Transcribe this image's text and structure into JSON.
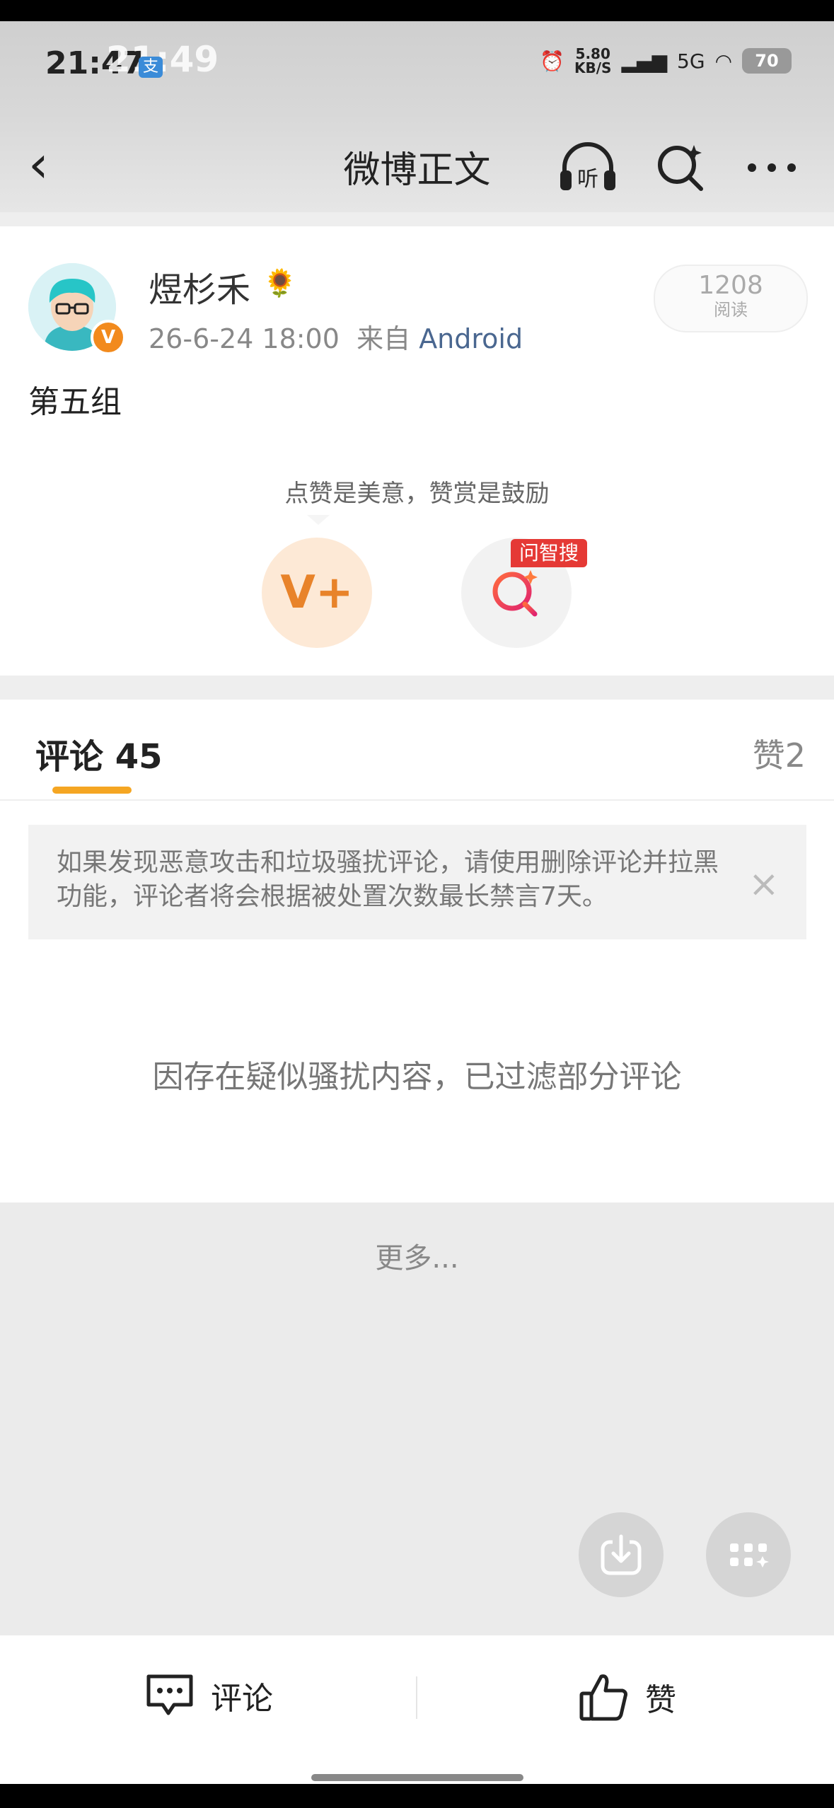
{
  "status_bar": {
    "time": "21:47",
    "time_overlay": "21:49",
    "notification_badge": "支",
    "net_speed_value": "5.80",
    "net_speed_unit": "KB/S",
    "network": "5G",
    "battery": "70"
  },
  "nav": {
    "title": "微博正文",
    "listen_label": "听"
  },
  "post": {
    "username": "煜杉禾",
    "username_emoji": "🌻",
    "verified_mark": "V",
    "timestamp": "26-6-24 18:00",
    "source_prefix": "来自",
    "source": "Android",
    "read_count": "1208",
    "read_label": "阅读",
    "content": "第五组",
    "reward_hint": "点赞是美意，赞赏是鼓励",
    "reward_icon_text": "V+",
    "zhisou_tag": "问智搜"
  },
  "tabs": {
    "comments_label": "评论",
    "comments_count": "45",
    "likes_label": "赞",
    "likes_count": "2"
  },
  "notice": {
    "text": "如果发现恶意攻击和垃圾骚扰评论，请使用删除评论并拉黑功能，评论者将会根据被处置次数最长禁言7天。",
    "close": "×"
  },
  "filtered_text": "因存在疑似骚扰内容，已过滤部分评论",
  "more_text": "更多...",
  "bottom_bar": {
    "comment_label": "评论",
    "like_label": "赞"
  },
  "colors": {
    "accent": "#f5a623",
    "verified": "#f28a1d",
    "link": "#4a6790",
    "zhisou_red": "#e53935"
  }
}
